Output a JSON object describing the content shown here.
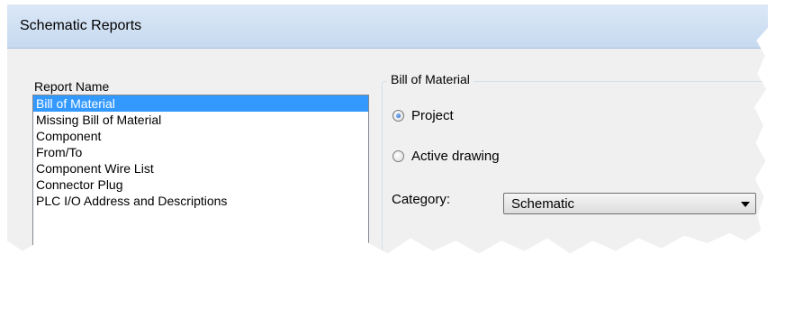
{
  "window": {
    "title": "Schematic Reports"
  },
  "report_name_label": "Report Name",
  "report_list": [
    {
      "label": "Bill of Material",
      "selected": true
    },
    {
      "label": "Missing Bill of Material",
      "selected": false
    },
    {
      "label": "Component",
      "selected": false
    },
    {
      "label": "From/To",
      "selected": false
    },
    {
      "label": "Component Wire List",
      "selected": false
    },
    {
      "label": "Connector Plug",
      "selected": false
    },
    {
      "label": "PLC I/O Address and Descriptions",
      "selected": false
    }
  ],
  "bom_group": {
    "label": "Bill of Material",
    "options": [
      {
        "label": "Project",
        "checked": true
      },
      {
        "label": "Active drawing",
        "checked": false
      }
    ],
    "category_label": "Category:",
    "category_value": "Schematic"
  },
  "colors": {
    "selection": "#3399ff",
    "titlebar": "#c6d9ef"
  }
}
